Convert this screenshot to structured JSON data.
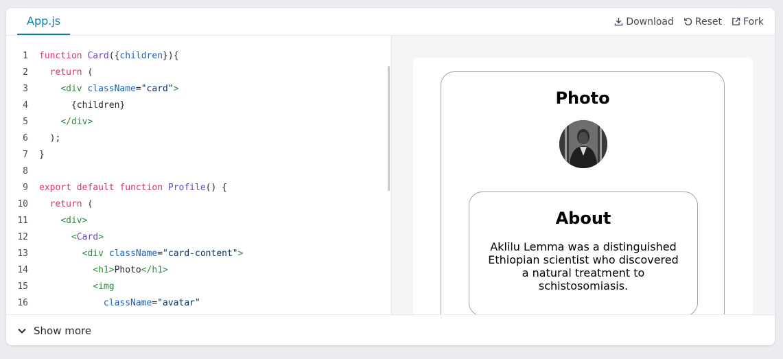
{
  "tab": {
    "label": "App.js"
  },
  "toolbar": {
    "download": "Download",
    "reset": "Reset",
    "fork": "Fork"
  },
  "editor": {
    "lines": [
      {
        "n": "1"
      },
      {
        "n": "2"
      },
      {
        "n": "3"
      },
      {
        "n": "4"
      },
      {
        "n": "5"
      },
      {
        "n": "6"
      },
      {
        "n": "7"
      },
      {
        "n": "8"
      },
      {
        "n": "9"
      },
      {
        "n": "10"
      },
      {
        "n": "11"
      },
      {
        "n": "12"
      },
      {
        "n": "13"
      },
      {
        "n": "14"
      },
      {
        "n": "15"
      },
      {
        "n": "16"
      }
    ],
    "t": {
      "function": "function",
      "card": "Card",
      "paren_open": "({",
      "children": "children",
      "close_brace_paren_brace": "}){",
      "return": "return",
      "paren": " (",
      "lt": "<",
      "gt": ">",
      "div": "div",
      "className": "className",
      "eq": "=",
      "card_str": "\"card\"",
      "children_expr": "{children}",
      "close_lt": "</",
      "semicolon": ");",
      "close_brace": "}",
      "export": "export",
      "default": "default",
      "profile": "Profile",
      "profile_tail": "() {",
      "card_content_str": "\"card-content\"",
      "h1": "h1",
      "photo": "Photo",
      "img": "img",
      "avatar_str": "\"avatar\""
    }
  },
  "preview": {
    "photo_title": "Photo",
    "about_title": "About",
    "about_text": "Aklilu Lemma was a distinguished Ethiopian scientist who discovered a natural treatment to schistosomiasis."
  },
  "footer": {
    "show_more": "Show more"
  },
  "colors": {
    "accent": "#087ea4",
    "keyword": "#d6336c",
    "function": "#6f42c1",
    "tag": "#2f8a3b",
    "attr": "#1d5fb4"
  },
  "icons": [
    "download-icon",
    "reset-icon",
    "fork-icon",
    "chevron-down-icon"
  ]
}
